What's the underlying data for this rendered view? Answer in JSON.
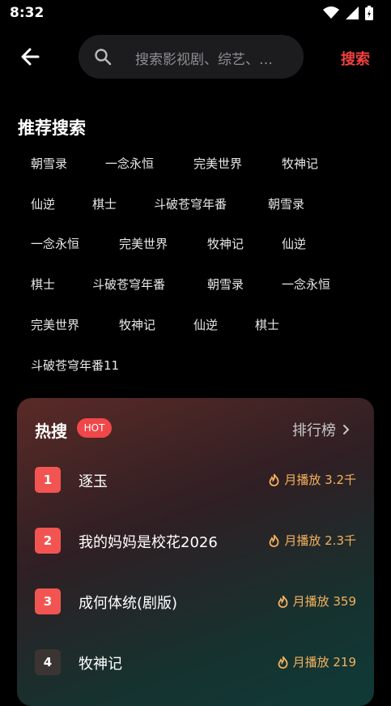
{
  "status_bar": {
    "time": "8:32"
  },
  "search": {
    "placeholder": "搜索影视剧、综艺、…",
    "button_label": "搜索"
  },
  "recommend": {
    "title": "推荐搜索",
    "tags": [
      "朝雪录",
      "一念永恒",
      "完美世界",
      "牧神记",
      "仙逆",
      "棋士",
      "斗破苍穹年番",
      "朝雪录",
      "一念永恒",
      "完美世界",
      "牧神记",
      "仙逆",
      "棋士",
      "斗破苍穹年番",
      "朝雪录",
      "一念永恒",
      "完美世界",
      "牧神记",
      "仙逆",
      "棋士",
      "斗破苍穹年番11"
    ]
  },
  "hot": {
    "title": "热搜",
    "badge": "HOT",
    "rank_link": "排行榜",
    "items": [
      {
        "rank": "1",
        "name": "逐玉",
        "plays": "月播放 3.2千"
      },
      {
        "rank": "2",
        "name": "我的妈妈是校花2026",
        "plays": "月播放 2.3千"
      },
      {
        "rank": "3",
        "name": "成何体统(剧版)",
        "plays": "月播放 359"
      },
      {
        "rank": "4",
        "name": "牧神记",
        "plays": "月播放 219"
      }
    ]
  },
  "colors": {
    "accent": "#f2413f",
    "hot_badge": "#f0474a",
    "plays": "#f5b05c"
  }
}
